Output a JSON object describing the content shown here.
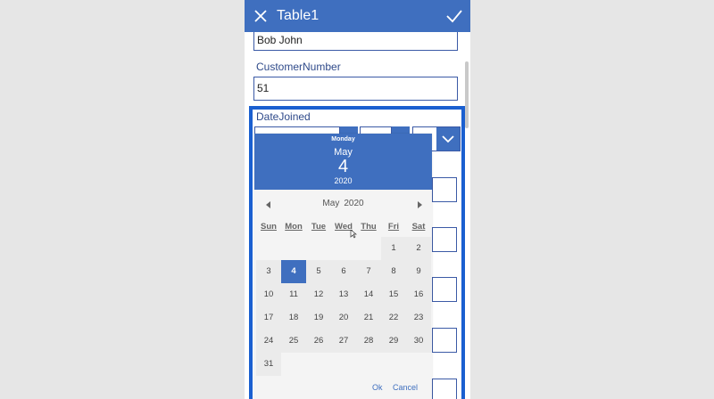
{
  "window": {
    "title": "Table1",
    "close_icon": "close-icon",
    "check_icon": "check-icon"
  },
  "form": {
    "name_value": "Bob John",
    "customer_number_label": "CustomerNumber",
    "customer_number_value": "51",
    "date_joined_label": "DateJoined"
  },
  "picker": {
    "header": {
      "weekday": "Monday",
      "month": "May",
      "day": "4",
      "year": "2020"
    },
    "nav": {
      "month": "May",
      "year": "2020",
      "prev_icon": "triangle-left-icon",
      "next_icon": "triangle-right-icon"
    },
    "weekdays": [
      "Sun",
      "Mon",
      "Tue",
      "Wed",
      "Thu",
      "Fri",
      "Sat"
    ],
    "days": [
      "1",
      "2",
      "3",
      "4",
      "5",
      "6",
      "7",
      "8",
      "9",
      "10",
      "11",
      "12",
      "13",
      "14",
      "15",
      "16",
      "17",
      "18",
      "19",
      "20",
      "21",
      "22",
      "23",
      "24",
      "25",
      "26",
      "27",
      "28",
      "29",
      "30",
      "31"
    ],
    "first_weekday_index": 5,
    "selected_day": "4",
    "ok_label": "Ok",
    "cancel_label": "Cancel"
  },
  "colors": {
    "accent": "#3f6fbf",
    "focus_border": "#1a5fd0",
    "label": "#2f4a8a"
  }
}
